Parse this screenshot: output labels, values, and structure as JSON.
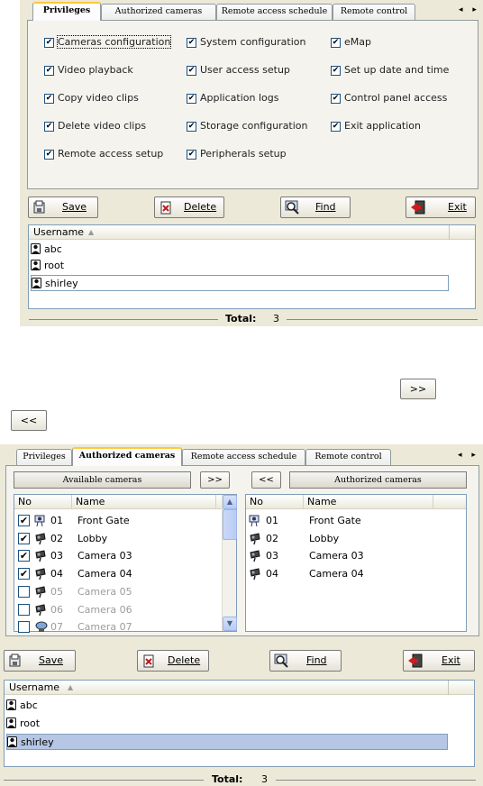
{
  "top_window": {
    "tabs": [
      {
        "label": "Privileges",
        "active": true
      },
      {
        "label": "Authorized cameras"
      },
      {
        "label": "Remote access schedule"
      },
      {
        "label": "Remote control"
      }
    ],
    "tab_scroll": "◂ ▸",
    "privileges": [
      {
        "label": "Cameras configuration",
        "checked": true
      },
      {
        "label": "System configuration",
        "checked": true
      },
      {
        "label": "eMap",
        "checked": true
      },
      {
        "label": "Video playback",
        "checked": true
      },
      {
        "label": "User access setup",
        "checked": true
      },
      {
        "label": "Set up date and time",
        "checked": true
      },
      {
        "label": "Copy video clips",
        "checked": true
      },
      {
        "label": "Application logs",
        "checked": true
      },
      {
        "label": "Control panel access",
        "checked": true
      },
      {
        "label": "Delete video clips",
        "checked": true
      },
      {
        "label": "Storage configuration",
        "checked": true
      },
      {
        "label": "Exit application",
        "checked": true
      },
      {
        "label": "Remote access setup",
        "checked": true
      },
      {
        "label": "Peripherals setup",
        "checked": true
      }
    ],
    "buttons": {
      "save": "Save",
      "delete": "Delete",
      "find": "Find",
      "exit": "Exit"
    },
    "user_list": {
      "header": "Username",
      "users": [
        "abc",
        "root",
        "shirley"
      ],
      "selected": "shirley"
    },
    "total_label": "Total:",
    "total_value": "3"
  },
  "standalone_buttons": {
    "add": ">>",
    "remove": "<<"
  },
  "bottom_window": {
    "tabs": [
      {
        "label": "Privileges"
      },
      {
        "label": "Authorized cameras",
        "active": true
      },
      {
        "label": "Remote access schedule"
      },
      {
        "label": "Remote control"
      }
    ],
    "tab_scroll": "◂ ▸",
    "available_caption": "Available cameras",
    "authorized_caption": "Authorized cameras",
    "add_btn": ">>",
    "remove_btn": "<<",
    "col_no": "No",
    "col_name": "Name",
    "available_cameras": [
      {
        "no": "01",
        "name": "Front Gate",
        "checked": true,
        "enabled": true
      },
      {
        "no": "02",
        "name": "Lobby",
        "checked": true,
        "enabled": true
      },
      {
        "no": "03",
        "name": "Camera 03",
        "checked": true,
        "enabled": true
      },
      {
        "no": "04",
        "name": "Camera 04",
        "checked": true,
        "enabled": true
      },
      {
        "no": "05",
        "name": "Camera 05",
        "checked": false,
        "enabled": false
      },
      {
        "no": "06",
        "name": "Camera 06",
        "checked": false,
        "enabled": false
      },
      {
        "no": "07",
        "name": "Camera 07",
        "checked": false,
        "enabled": false
      }
    ],
    "authorized_cameras": [
      {
        "no": "01",
        "name": "Front Gate"
      },
      {
        "no": "02",
        "name": "Lobby"
      },
      {
        "no": "03",
        "name": "Camera 03"
      },
      {
        "no": "04",
        "name": "Camera 04"
      }
    ],
    "buttons": {
      "save": "Save",
      "delete": "Delete",
      "find": "Find",
      "exit": "Exit"
    },
    "user_list": {
      "header": "Username",
      "users": [
        "abc",
        "root",
        "shirley"
      ],
      "selected": "shirley"
    },
    "total_label": "Total:",
    "total_value": "3"
  },
  "colors": {
    "selection": "#b6c7e5",
    "tab_highlight": "#ffc83c",
    "panel": "#ece9d8"
  }
}
